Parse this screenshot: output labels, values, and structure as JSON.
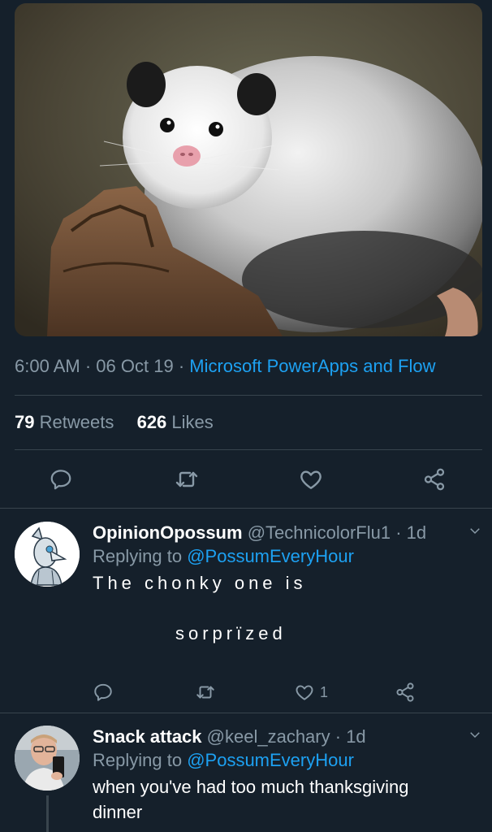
{
  "tweet": {
    "image_subject": "opossum-photo",
    "time": "6:00 AM",
    "separator": "·",
    "date": "06 Oct 19",
    "source": "Microsoft PowerApps and Flow",
    "retweet_count": "79",
    "retweet_label": "Retweets",
    "like_count": "626",
    "like_label": "Likes",
    "actions": [
      "reply-icon",
      "retweet-icon",
      "like-icon",
      "share-icon"
    ]
  },
  "replies": [
    {
      "name": "OpinionOpossum",
      "handle": "@TechnicolorFlu1",
      "time": "· 1d",
      "replying_prefix": "Replying to",
      "replying_to": "@PossumEveryHour",
      "text_line1": "The chonky one is",
      "text_line2": "sorprïzed",
      "like_count": "1"
    },
    {
      "name": "Snack attack",
      "handle": "@keel_zachary",
      "time": "· 1d",
      "replying_prefix": "Replying to",
      "replying_to": "@PossumEveryHour",
      "text_line1": "when you've had too much thanksgiving",
      "text_line2": "dinner"
    }
  ],
  "colors": {
    "background": "#15202b",
    "accent": "#1da1f2",
    "muted": "#8899a6",
    "divider": "#38444d"
  }
}
